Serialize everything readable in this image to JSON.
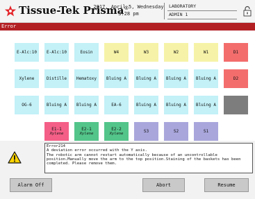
{
  "header": {
    "brand": "Tissue-Tek Prisma",
    "brand_mark": "®",
    "date": "2017, April 5, Wednesday",
    "time": "3:28 pm",
    "location": "LABORATORY",
    "user": "ADMIN 1"
  },
  "error_bar": {
    "label": "Error"
  },
  "grid": {
    "rows": [
      [
        {
          "label": "E-Alc:10",
          "color": "cyan"
        },
        {
          "label": "E-Alc:10",
          "color": "cyan"
        },
        {
          "label": "Eosin",
          "color": "cyan"
        },
        {
          "label": "W4",
          "color": "yellow"
        },
        {
          "label": "W3",
          "color": "yellow"
        },
        {
          "label": "W2",
          "color": "yellow"
        },
        {
          "label": "W1",
          "color": "yellow"
        },
        {
          "label": "D1",
          "color": "red"
        }
      ],
      [
        {
          "label": "Xylene",
          "color": "cyan"
        },
        {
          "label": "Distille",
          "color": "cyan"
        },
        {
          "label": "Hematoxy",
          "color": "cyan"
        },
        {
          "label": "Bluing A",
          "color": "cyan"
        },
        {
          "label": "Bluing A",
          "color": "cyan"
        },
        {
          "label": "Bluing A",
          "color": "cyan"
        },
        {
          "label": "Bluing A",
          "color": "cyan"
        },
        {
          "label": "D2",
          "color": "red"
        }
      ],
      [
        {
          "label": "OG-6",
          "color": "cyan"
        },
        {
          "label": "Bluing A",
          "color": "cyan"
        },
        {
          "label": "Bluing A",
          "color": "cyan"
        },
        {
          "label": "EA-6",
          "color": "cyan"
        },
        {
          "label": "Bluing A",
          "color": "cyan"
        },
        {
          "label": "Bluing A",
          "color": "cyan"
        },
        {
          "label": "Bluing A",
          "color": "cyan"
        },
        {
          "label": "",
          "color": "gray"
        }
      ],
      [
        {
          "label": "",
          "color": "empty"
        },
        {
          "label": "E1-1",
          "sub": "Xylene",
          "color": "pink"
        },
        {
          "label": "E2-1",
          "sub": "Xylene",
          "color": "green"
        },
        {
          "label": "E2-2",
          "sub": "Xylene",
          "color": "green"
        },
        {
          "label": "S3",
          "color": "purple"
        },
        {
          "label": "S2",
          "color": "purple"
        },
        {
          "label": "S1",
          "color": "purple"
        },
        {
          "label": "",
          "color": "empty"
        }
      ]
    ]
  },
  "message": {
    "code": "Error214",
    "lines": [
      "A deviation error occurred with the Y axis.",
      "The robotic arm cannot restart automatically because of an uncontrollable",
      "position.Manually move the arm to the top position.Staining of the baskets has been",
      "completed. Please remove them."
    ]
  },
  "buttons": {
    "alarm_off": "Alarm Off",
    "abort": "Abort",
    "resume": "Resume"
  },
  "colors": {
    "error_bar": "#b32024",
    "cyan": "#c3f1f7",
    "yellow": "#f6f3a8",
    "red": "#f36d6d",
    "gray": "#7d7d7d",
    "pink": "#f45f87",
    "green": "#53c58a",
    "purple": "#a9a6dc",
    "logo": "#e3262b"
  },
  "icons": {
    "logo": "star-logo-icon",
    "lock": "lock-icon",
    "warning": "warning-icon"
  }
}
